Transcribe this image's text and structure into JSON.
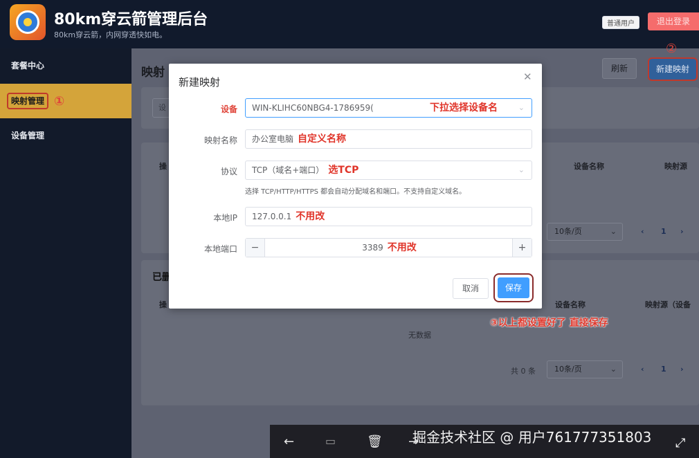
{
  "header": {
    "app_title": "80km穿云箭管理后台",
    "app_subtitle": "80km穿云箭，内网穿透快如电。",
    "user_badge": "普通用户",
    "logout": "退出登录"
  },
  "sidebar": {
    "items": [
      {
        "label": "套餐中心"
      },
      {
        "label": "映射管理",
        "annotation": "①"
      },
      {
        "label": "设备管理"
      }
    ]
  },
  "main": {
    "page_title": "映射",
    "refresh": "刷新",
    "new_mapping": "新建映射",
    "new_annotation": "②",
    "filter_placeholder": "设",
    "table1": {
      "col_op": "操",
      "col_device": "设备名称",
      "col_source": "映射源",
      "page_size": "10条/页",
      "page": "1"
    },
    "section2_title": "已删",
    "table2": {
      "col_op": "操",
      "col_device": "设备名称",
      "col_source": "映射源（设备",
      "empty": "无数据",
      "total": "共 0 条",
      "page_size": "10条/页",
      "page": "1"
    }
  },
  "dialog": {
    "title": "新建映射",
    "device_label": "设备",
    "device_value": "WIN-KLIHC60NBG4-1786959(",
    "device_note": "下拉选择设备名",
    "name_label": "映射名称",
    "name_value": "办公室电脑",
    "name_note": "自定义名称",
    "protocol_label": "协议",
    "protocol_value": "TCP（域名+端口）",
    "protocol_note": "选TCP",
    "protocol_hint": "选择 TCP/HTTP/HTTPS 都会自动分配域名和端口。不支持自定义域名。",
    "ip_label": "本地IP",
    "ip_value": "127.0.0.1",
    "ip_note": "不用改",
    "port_label": "本地端口",
    "port_value": "3389",
    "port_note": "不用改",
    "cancel": "取消",
    "save": "保存"
  },
  "annotation_save": "③以上都设置好了 直接保存",
  "viewer": {
    "watermark": "掘金技术社区 @ 用户761777351803"
  }
}
